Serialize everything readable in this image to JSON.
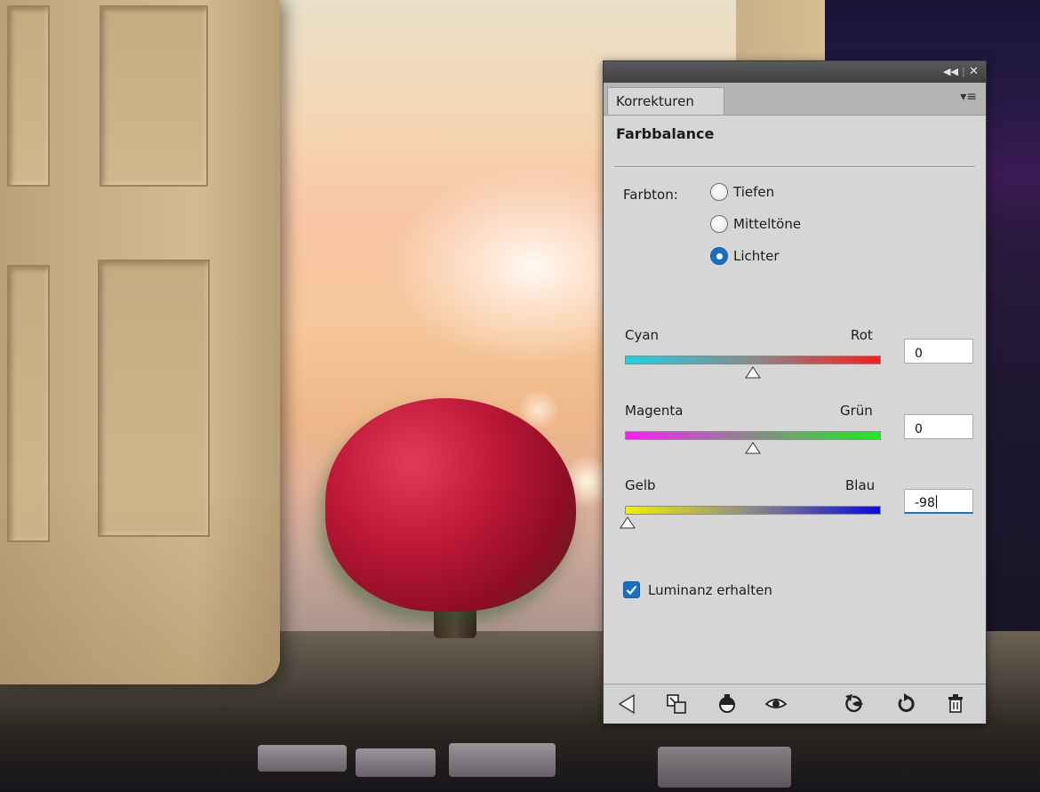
{
  "panel": {
    "tab_label": "Korrekturen",
    "heading": "Farbbalance",
    "titlebar_icons": [
      "collapse-icon",
      "close-icon"
    ],
    "menu_icon": "panel-menu-icon"
  },
  "tone": {
    "label": "Farbton:",
    "options": [
      "Tiefen",
      "Mitteltöne",
      "Lichter"
    ],
    "selected": "Lichter"
  },
  "sliders": [
    {
      "left": "Cyan",
      "right": "Rot",
      "value": "0",
      "value_num": 0,
      "min": -100,
      "max": 100,
      "colors": [
        "#1ad3e6",
        "#ff1a1a"
      ]
    },
    {
      "left": "Magenta",
      "right": "Grün",
      "value": "0",
      "value_num": 0,
      "min": -100,
      "max": 100,
      "colors": [
        "#ff1aff",
        "#1aee1a"
      ]
    },
    {
      "left": "Gelb",
      "right": "Blau",
      "value": "-98",
      "value_num": -98,
      "min": -100,
      "max": 100,
      "colors": [
        "#f5ee00",
        "#0a0adc"
      ]
    }
  ],
  "luminance": {
    "label": "Luminanz erhalten",
    "checked": true
  },
  "footer_icons": [
    "back-arrow-icon",
    "clip-to-layer-icon",
    "view-previous-state-icon",
    "visibility-eye-icon",
    "reset-previous-icon",
    "reset-icon",
    "trash-icon"
  ]
}
